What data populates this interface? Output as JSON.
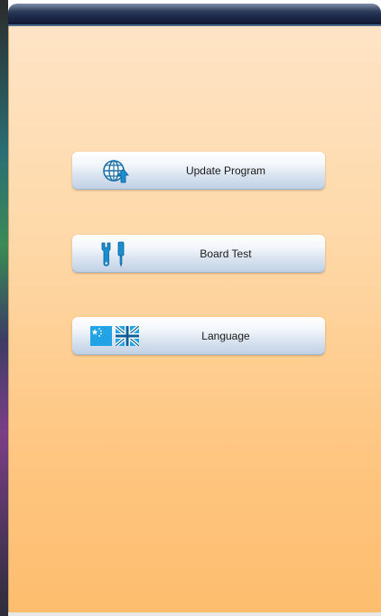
{
  "menu": {
    "update_program": {
      "label": "Update Program",
      "icon": "globe-update-icon"
    },
    "board_test": {
      "label": "Board Test",
      "icon": "tools-icon"
    },
    "language": {
      "label": "Language",
      "icons": [
        "flag-china-icon",
        "flag-uk-icon"
      ]
    }
  },
  "colors": {
    "panel_top": "#fee4c6",
    "panel_bottom": "#fdbd6e",
    "title_bar": "#1c2846",
    "button_top": "#ffffff",
    "button_bottom": "#bfd0e4",
    "icon_blue": "#1a8fd0"
  }
}
